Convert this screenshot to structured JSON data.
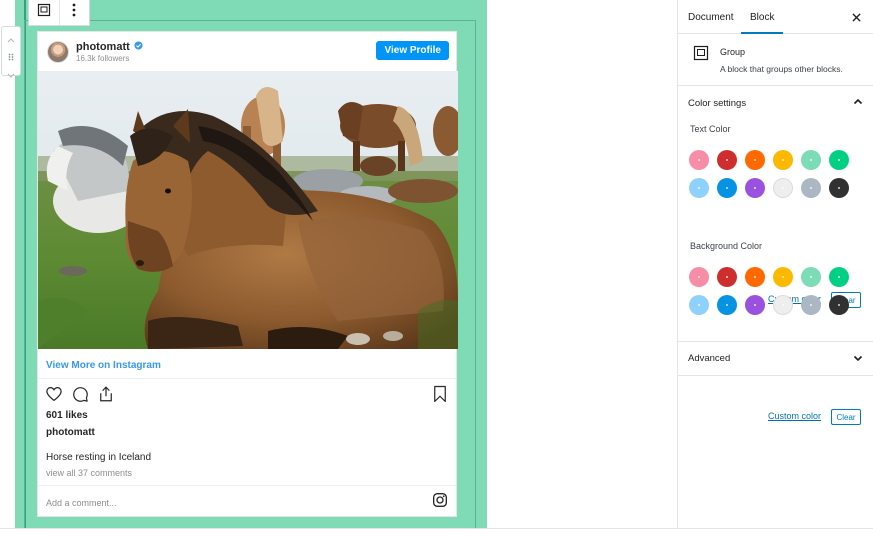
{
  "toolbar": {
    "block_type_icon": "group-icon",
    "more_icon": "more-vertical-icon"
  },
  "mover": {
    "up_icon": "chevron-up-icon",
    "drag_icon": "drag-handle-icon",
    "down_icon": "chevron-down-icon"
  },
  "instagram": {
    "username": "photomatt",
    "followers": "16.3k followers",
    "view_profile": "View Profile",
    "view_more": "View More on Instagram",
    "likes": "601 likes",
    "owner": "photomatt",
    "caption": "Horse resting in Iceland",
    "comments_link": "view all 37 comments",
    "comment_placeholder": "Add a comment...",
    "accent": "#0095f6"
  },
  "sidebar": {
    "tabs": [
      {
        "label": "Document"
      },
      {
        "label": "Block",
        "active": true
      }
    ],
    "close_icon": "close-icon",
    "block_card": {
      "name": "Group",
      "description": "A block that groups other blocks."
    },
    "color_settings": {
      "title": "Color settings",
      "text_color_label": "Text Color",
      "background_color_label": "Background Color",
      "custom_color": "Custom color",
      "clear": "Clear",
      "palette": [
        "#f78da7",
        "#cf2e2e",
        "#ff6900",
        "#fcb900",
        "#7bdcb5",
        "#00d084",
        "#8ed1fc",
        "#0693e3",
        "#9b51e0",
        "#eeeeee",
        "#abb8c3",
        "#313131"
      ]
    },
    "advanced": {
      "title": "Advanced"
    }
  },
  "colors": {
    "group_background": "#7fdbb6",
    "primary": "#007cba"
  }
}
